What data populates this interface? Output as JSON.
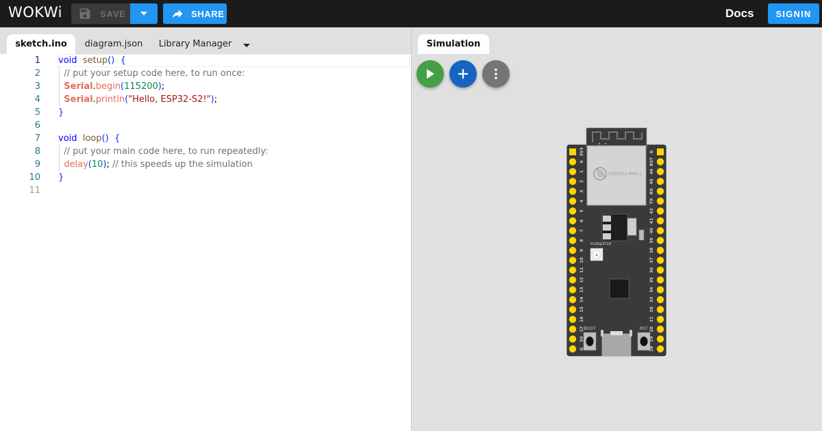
{
  "app": {
    "logo": "WOKWi",
    "toolbar": {
      "save_label": "SAVE",
      "share_label": "SHARE",
      "docs_label": "Docs",
      "signin_label": "SIGNIN"
    },
    "colors": {
      "topbar": "#1b1b1b",
      "accent": "#2196f3",
      "play": "#43a047",
      "add": "#1565c0",
      "more": "#757575",
      "pin": "#ffd400",
      "board": "#3a3a3a"
    }
  },
  "editor": {
    "tabs": [
      {
        "label": "sketch.ino",
        "active": true
      },
      {
        "label": "diagram.json",
        "active": false
      },
      {
        "label": "Library Manager",
        "active": false
      }
    ],
    "current_line": 1,
    "lines": [
      {
        "n": "1",
        "tokens": [
          [
            "k",
            "void"
          ],
          [
            "",
            "  "
          ],
          [
            "fn",
            "setup"
          ],
          [
            "br",
            "()"
          ],
          [
            "",
            "  "
          ],
          [
            "br",
            "{"
          ]
        ]
      },
      {
        "n": "2",
        "tokens": [
          [
            "cm",
            "  // put your setup code here, to run once:"
          ]
        ]
      },
      {
        "n": "3",
        "tokens": [
          [
            "",
            "  "
          ],
          [
            "cls",
            "Serial"
          ],
          [
            "",
            "."
          ],
          [
            "mth",
            "begin"
          ],
          [
            "br",
            "("
          ],
          [
            "num",
            "115200"
          ],
          [
            "br",
            ")"
          ],
          [
            "",
            ";"
          ]
        ]
      },
      {
        "n": "4",
        "tokens": [
          [
            "",
            "  "
          ],
          [
            "cls",
            "Serial"
          ],
          [
            "",
            "."
          ],
          [
            "mth",
            "println"
          ],
          [
            "br",
            "("
          ],
          [
            "str",
            "\"Hello, ESP32-S2!\""
          ],
          [
            "br",
            ")"
          ],
          [
            "",
            ";"
          ]
        ]
      },
      {
        "n": "5",
        "tokens": [
          [
            "br",
            "}"
          ]
        ]
      },
      {
        "n": "6",
        "tokens": []
      },
      {
        "n": "7",
        "tokens": [
          [
            "k",
            "void"
          ],
          [
            "",
            "  "
          ],
          [
            "fn",
            "loop"
          ],
          [
            "br",
            "()"
          ],
          [
            "",
            "  "
          ],
          [
            "br",
            "{"
          ]
        ]
      },
      {
        "n": "8",
        "tokens": [
          [
            "cm",
            "  // put your main code here, to run repeatedly:"
          ]
        ]
      },
      {
        "n": "9",
        "tokens": [
          [
            "",
            "  "
          ],
          [
            "mth",
            "delay"
          ],
          [
            "br",
            "("
          ],
          [
            "num",
            "10"
          ],
          [
            "br",
            ")"
          ],
          [
            "",
            ";"
          ],
          [
            "cm",
            " // this speeds up the simulation"
          ]
        ]
      },
      {
        "n": "10",
        "tokens": [
          [
            "br",
            "}"
          ]
        ]
      },
      {
        "n": "11",
        "tokens": []
      }
    ]
  },
  "simulation": {
    "tab_label": "Simulation",
    "buttons": [
      "start-simulation",
      "add-part",
      "more-options"
    ],
    "board": {
      "module_label": "ESP32S2-MINI-1",
      "led_label": "RGB@IO18",
      "boot_label": "BOOT",
      "rst_label": "RST",
      "left_pins": [
        "3V3",
        "0",
        "1",
        "2",
        "3",
        "4",
        "5",
        "6",
        "7",
        "8",
        "9",
        "10",
        "11",
        "12",
        "13",
        "14",
        "15",
        "16",
        "17",
        "5V",
        "G"
      ],
      "right_pins": [
        "G",
        "RST",
        "46",
        "45",
        "RX",
        "TX",
        "42",
        "41",
        "40",
        "39",
        "38",
        "37",
        "36",
        "35",
        "34",
        "33",
        "26",
        "21",
        "20",
        "19",
        "18"
      ]
    }
  }
}
